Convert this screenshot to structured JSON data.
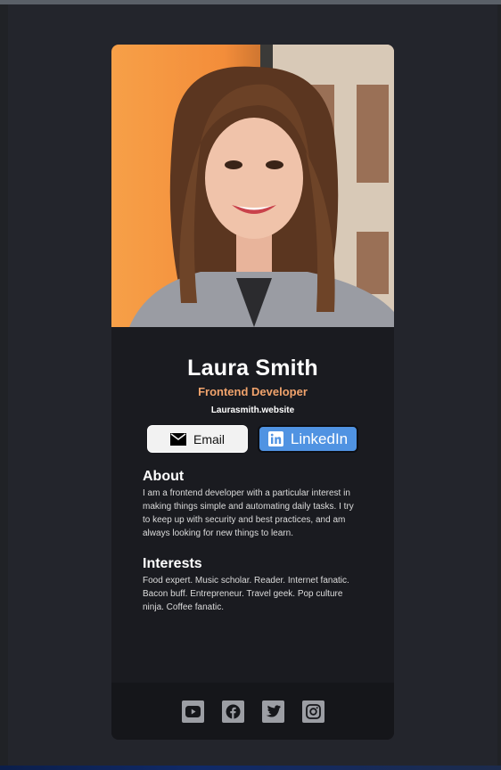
{
  "profile": {
    "name": "Laura Smith",
    "role": "Frontend Developer",
    "website": "Laurasmith.website"
  },
  "buttons": {
    "email_label": "Email",
    "linkedin_label": "LinkedIn"
  },
  "about": {
    "heading": "About",
    "text": "I am a frontend developer with a particular interest in making things simple and automating daily tasks. I try to keep up with security and best practices, and am always looking for new things to learn."
  },
  "interests": {
    "heading": "Interests",
    "text": "Food expert. Music scholar. Reader. Internet fanatic. Bacon buff. Entrepreneur. Travel geek. Pop culture ninja. Coffee fanatic."
  },
  "footer": {
    "icons": [
      "youtube-icon",
      "facebook-icon",
      "twitter-icon",
      "instagram-icon"
    ]
  },
  "colors": {
    "page_bg": "#23252c",
    "card_bg": "#1a1b20",
    "footer_bg": "#15161a",
    "accent": "#f1a36c",
    "linkedin": "#5093e2",
    "email_button": "#f2f2f2"
  }
}
